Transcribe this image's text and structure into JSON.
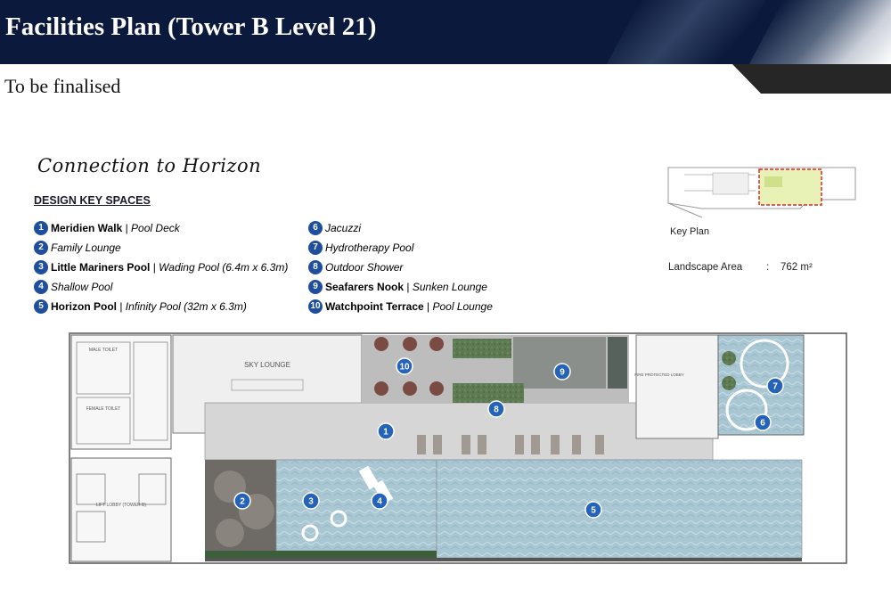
{
  "header": {
    "title": "Facilities Plan (Tower B Level 21)"
  },
  "subtitle": "To be finalised",
  "plan": {
    "title": "Connection to Horizon",
    "key_heading": "DESIGN KEY SPACES",
    "legend": [
      {
        "num": "1",
        "bold": "Meridien Walk",
        "sep": " | ",
        "italic": "Pool Deck"
      },
      {
        "num": "2",
        "bold": "",
        "sep": "",
        "italic": "Family Lounge"
      },
      {
        "num": "3",
        "bold": "Little Mariners Pool",
        "sep": " | ",
        "italic": "Wading Pool (6.4m x 6.3m)"
      },
      {
        "num": "4",
        "bold": "",
        "sep": "",
        "italic": "Shallow Pool"
      },
      {
        "num": "5",
        "bold": "Horizon Pool",
        "sep": " | ",
        "italic": "Infinity Pool (32m x 6.3m)"
      },
      {
        "num": "6",
        "bold": "",
        "sep": "",
        "italic": "Jacuzzi"
      },
      {
        "num": "7",
        "bold": "",
        "sep": "",
        "italic": "Hydrotherapy Pool"
      },
      {
        "num": "8",
        "bold": "",
        "sep": "",
        "italic": "Outdoor Shower"
      },
      {
        "num": "9",
        "bold": "Seafarers Nook",
        "sep": " | ",
        "italic": "Sunken Lounge"
      },
      {
        "num": "10",
        "bold": "Watchpoint Terrace",
        "sep": " | ",
        "italic": "Pool Lounge"
      }
    ],
    "key_plan_label": "Key Plan",
    "landscape_area_label": "Landscape Area",
    "landscape_area_sep": ":",
    "landscape_area_value": "762 m²",
    "rooms": {
      "sky_lounge": "SKY LOUNGE",
      "male_toilet": "MALE TOILET",
      "female_toilet": "FEMALE TOILET",
      "lift_lobby": "LIFT LOBBY (TOWER B)",
      "fire_lobby": "FIRE PROTECTED LOBBY"
    },
    "colors": {
      "badge": "#1f4e9c",
      "water": "#a9c7d2",
      "deck": "#bdbdbd",
      "planting": "#5d7a52"
    }
  }
}
